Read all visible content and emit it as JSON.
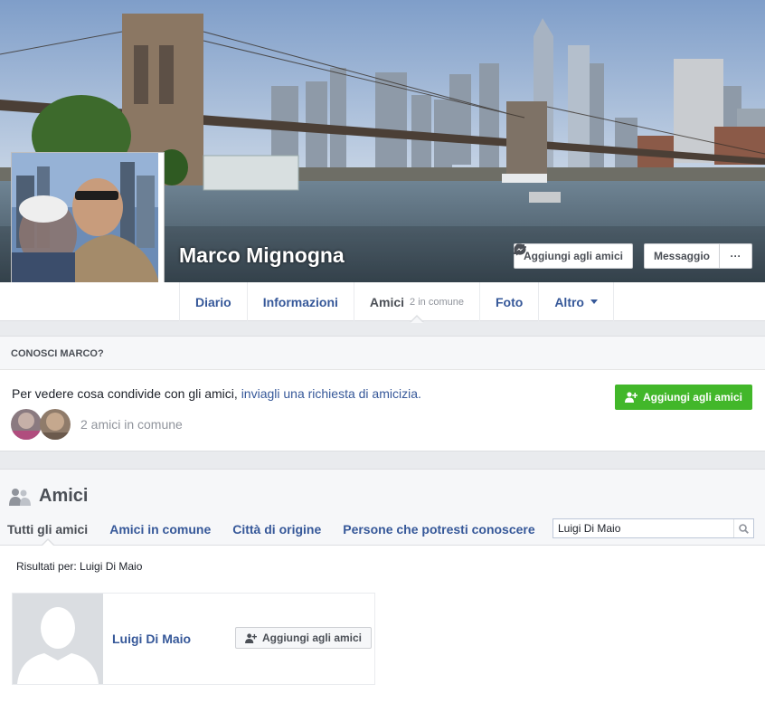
{
  "profile": {
    "name": "Marco Mignogna",
    "add_friend_label": "Aggiungi agli amici",
    "message_label": "Messaggio",
    "more_label": "···"
  },
  "tabs": [
    {
      "label": "Diario",
      "sub": ""
    },
    {
      "label": "Informazioni",
      "sub": ""
    },
    {
      "label": "Amici",
      "sub": "2 in comune"
    },
    {
      "label": "Foto",
      "sub": ""
    },
    {
      "label": "Altro",
      "sub": ""
    }
  ],
  "know": {
    "heading": "CONOSCI MARCO?",
    "text": "Per vedere cosa condivide con gli amici, ",
    "link": "inviagli una richiesta di amicizia.",
    "button": "Aggiungi agli amici",
    "mutual": "2 amici in comune"
  },
  "friends": {
    "title": "Amici",
    "subtabs": [
      "Tutti gli amici",
      "Amici in comune",
      "Città di origine",
      "Persone che potresti conoscere"
    ],
    "search_value": "Luigi Di Maio",
    "results_for": "Risultati per: Luigi Di Maio",
    "result": {
      "name": "Luigi Di Maio",
      "button": "Aggiungi agli amici"
    }
  },
  "colors": {
    "link": "#365899",
    "green": "#42b72a",
    "bg": "#e9ebee"
  },
  "icons": {
    "add_friend": "add-friend-icon",
    "messenger": "messenger-icon",
    "friends": "friends-icon",
    "search": "search-icon"
  }
}
